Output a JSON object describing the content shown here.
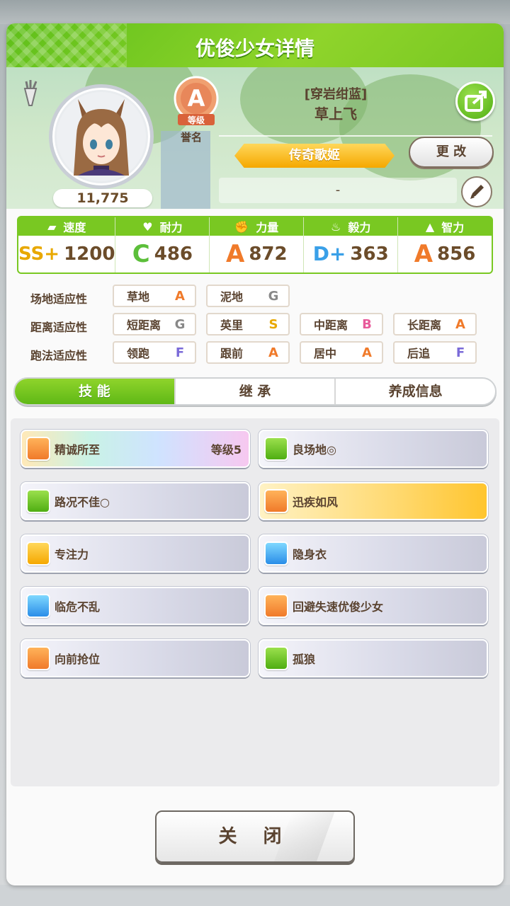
{
  "window": {
    "title": "优俊少女详情"
  },
  "profile": {
    "fans": "11,775",
    "rank_grade": "A",
    "rank_level_label": "等级",
    "rank_name_label": "誉名",
    "epithet": "[穿岩绀蓝]",
    "name": "草上飞",
    "title_badge": "传奇歌姬",
    "change_label": "更 改",
    "memo": "-"
  },
  "stats": [
    {
      "label": "速度",
      "grade": "SS+",
      "value": "1200",
      "icon": "shoe-icon"
    },
    {
      "label": "耐力",
      "grade": "C",
      "value": "486",
      "icon": "heart-icon"
    },
    {
      "label": "力量",
      "grade": "A",
      "value": "872",
      "icon": "muscle-icon"
    },
    {
      "label": "毅力",
      "grade": "D+",
      "value": "363",
      "icon": "flame-icon"
    },
    {
      "label": "智力",
      "grade": "A",
      "value": "856",
      "icon": "graduation-cap-icon"
    }
  ],
  "aptitude": {
    "track_label": "场地适应性",
    "distance_label": "距离适应性",
    "style_label": "跑法适应性",
    "track": [
      {
        "name": "草地",
        "grade": "A"
      },
      {
        "name": "泥地",
        "grade": "G"
      }
    ],
    "distance": [
      {
        "name": "短距离",
        "grade": "G"
      },
      {
        "name": "英里",
        "grade": "S"
      },
      {
        "name": "中距离",
        "grade": "B"
      },
      {
        "name": "长距离",
        "grade": "A"
      }
    ],
    "style": [
      {
        "name": "领跑",
        "grade": "F"
      },
      {
        "name": "跟前",
        "grade": "A"
      },
      {
        "name": "居中",
        "grade": "A"
      },
      {
        "name": "后追",
        "grade": "F"
      }
    ]
  },
  "tabs": [
    {
      "label": "技 能"
    },
    {
      "label": "继 承"
    },
    {
      "label": "养成信息"
    }
  ],
  "skills": [
    {
      "name": "精诚所至",
      "level": "等级5",
      "style": "rainbow"
    },
    {
      "name": "良场地◎",
      "level": "",
      "style": "silver"
    },
    {
      "name": "路况不佳○",
      "level": "",
      "style": "silver"
    },
    {
      "name": "迅疾如风",
      "level": "",
      "style": "gold"
    },
    {
      "name": "专注力",
      "level": "",
      "style": "silver"
    },
    {
      "name": "隐身衣",
      "level": "",
      "style": "silver"
    },
    {
      "name": "临危不乱",
      "level": "",
      "style": "silver"
    },
    {
      "name": "回避失速优俊少女",
      "level": "",
      "style": "silver"
    },
    {
      "name": "向前抢位",
      "level": "",
      "style": "silver"
    },
    {
      "name": "孤狼",
      "level": "",
      "style": "silver"
    }
  ],
  "close_label": "关 闭",
  "colors": {
    "accent": "#79c822",
    "text": "#5a4330",
    "gold": "#f5a800"
  }
}
